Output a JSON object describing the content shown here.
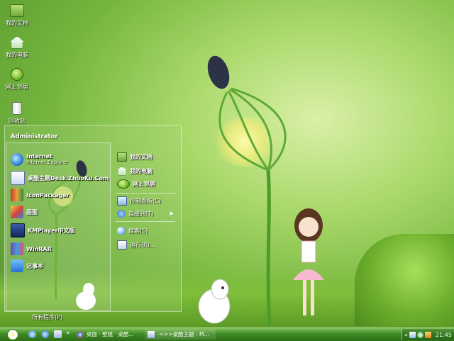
{
  "desktop": {
    "icons": [
      {
        "label": "我的文档",
        "icon": "my-documents-folder-icon"
      },
      {
        "label": "我的电脑",
        "icon": "my-computer-icon"
      },
      {
        "label": "网上邻居",
        "icon": "network-places-icon"
      },
      {
        "label": "回收站",
        "icon": "recycle-bin-icon"
      }
    ]
  },
  "start_menu": {
    "user": "Administrator",
    "pinned": [
      {
        "label": "Internet",
        "sublabel": "Internet Explorer",
        "icon": "internet-explorer-icon"
      },
      {
        "label": "桌酷主题Desk.ZhuoKu.Com",
        "icon": "theme-icon"
      },
      {
        "label": "IconPackager",
        "icon": "iconpackager-icon"
      },
      {
        "label": "画图",
        "icon": "paint-icon"
      },
      {
        "label": "KMPlayer中文版",
        "icon": "kmplayer-icon"
      },
      {
        "label": "WinRAR",
        "icon": "winrar-icon"
      },
      {
        "label": "记事本",
        "icon": "notepad-icon"
      }
    ],
    "all_programs": "所有程序(P)",
    "right": [
      {
        "label": "我的文档",
        "icon": "my-documents-folder-icon",
        "bold": true
      },
      {
        "label": "我的电脑",
        "icon": "my-computer-icon",
        "bold": true
      },
      {
        "label": "网上邻居",
        "icon": "network-places-icon",
        "bold": true
      },
      {
        "label": "控制面板(C)",
        "icon": "control-panel-icon",
        "bold": false
      },
      {
        "label": "连接到(T)",
        "icon": "connect-to-icon",
        "bold": false
      },
      {
        "label": "搜索(S)",
        "icon": "search-icon",
        "bold": false
      },
      {
        "label": "运行(R)...",
        "icon": "run-icon",
        "bold": false
      }
    ]
  },
  "taskbar": {
    "tasks": [
      {
        "label": "桌面 · 壁纸 · 桌酷...",
        "icon": "chrome-icon"
      },
      {
        "label": "-=>>桌酷主题 - M...",
        "icon": "window-icon"
      }
    ],
    "clock": "21:45"
  }
}
